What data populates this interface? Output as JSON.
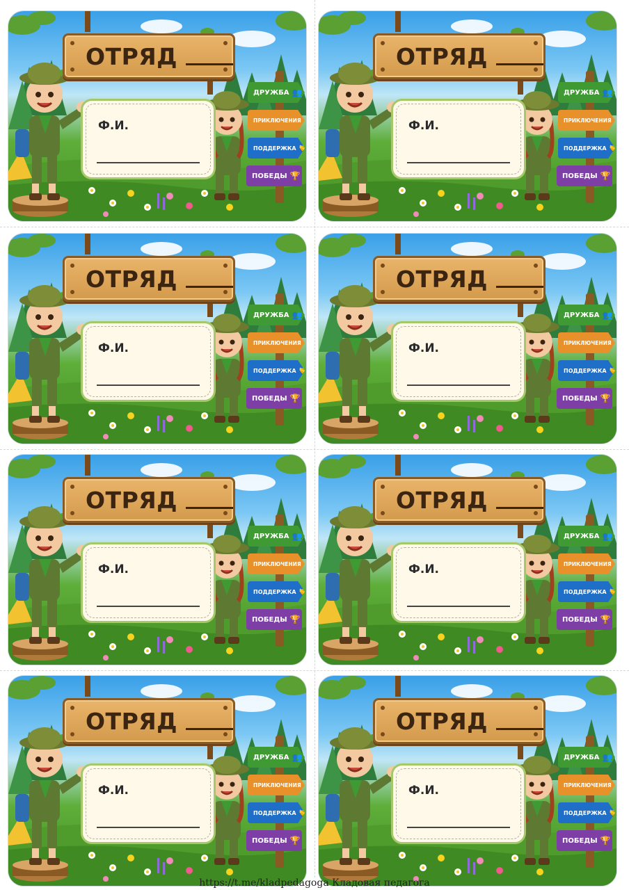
{
  "badges": [
    {
      "title": "ОТРЯД",
      "name_label": "Ф.И."
    },
    {
      "title": "ОТРЯД",
      "name_label": "Ф.И."
    },
    {
      "title": "ОТРЯД",
      "name_label": "Ф.И."
    },
    {
      "title": "ОТРЯД",
      "name_label": "Ф.И."
    },
    {
      "title": "ОТРЯД",
      "name_label": "Ф.И."
    },
    {
      "title": "ОТРЯД",
      "name_label": "Ф.И."
    },
    {
      "title": "ОТРЯД",
      "name_label": "Ф.И."
    },
    {
      "title": "ОТРЯД",
      "name_label": "Ф.И."
    }
  ],
  "signs": [
    {
      "label": "ДРУЖБА",
      "icon": "people-icon",
      "color": "#3f9a33"
    },
    {
      "label": "ПРИКЛЮЧЕНИЯ",
      "icon": "mountain-icon",
      "color": "#e8902a"
    },
    {
      "label": "ПОДДЕРЖКА",
      "icon": "handshake-icon",
      "color": "#1f6fc9"
    },
    {
      "label": "ПОБЕДЫ",
      "icon": "trophy-icon",
      "color": "#7d3fa6"
    }
  ],
  "footer": {
    "text": "https://t.me/kladpedagoga Кладовая педагога"
  }
}
